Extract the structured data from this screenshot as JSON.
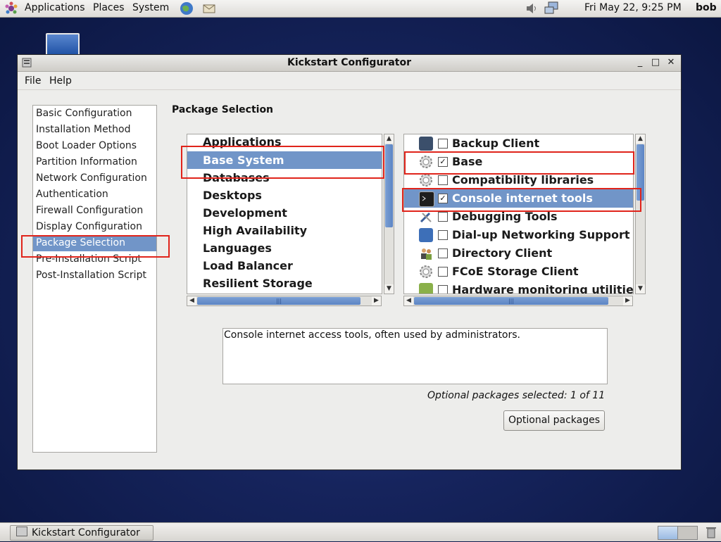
{
  "top_panel": {
    "menus": [
      "Applications",
      "Places",
      "System"
    ],
    "clock": "Fri May 22,  9:25 PM",
    "user": "bob"
  },
  "window": {
    "title": "Kickstart Configurator",
    "menu": [
      "File",
      "Help"
    ]
  },
  "nav": {
    "items": [
      "Basic Configuration",
      "Installation Method",
      "Boot Loader Options",
      "Partition Information",
      "Network Configuration",
      "Authentication",
      "Firewall Configuration",
      "Display Configuration",
      "Package Selection",
      "Pre-Installation Script",
      "Post-Installation Script"
    ],
    "selected": "Package Selection"
  },
  "main": {
    "section_title": "Package Selection",
    "groups": {
      "items": [
        "Applications",
        "Base System",
        "Databases",
        "Desktops",
        "Development",
        "High Availability",
        "Languages",
        "Load Balancer",
        "Resilient Storage"
      ],
      "selected": "Base System"
    },
    "packages": {
      "items": [
        {
          "label": "Backup Client",
          "checked": false,
          "icon": "backup-icon",
          "selected": false
        },
        {
          "label": "Base",
          "checked": true,
          "icon": "gear-icon",
          "selected": false
        },
        {
          "label": "Compatibility libraries",
          "checked": false,
          "icon": "gear-icon",
          "selected": false
        },
        {
          "label": "Console internet tools",
          "checked": true,
          "icon": "terminal-icon",
          "selected": true
        },
        {
          "label": "Debugging Tools",
          "checked": false,
          "icon": "tools-icon",
          "selected": false
        },
        {
          "label": "Dial-up Networking Support",
          "checked": false,
          "icon": "phone-icon",
          "selected": false
        },
        {
          "label": "Directory Client",
          "checked": false,
          "icon": "users-icon",
          "selected": false
        },
        {
          "label": "FCoE Storage Client",
          "checked": false,
          "icon": "gear-icon",
          "selected": false
        },
        {
          "label": "Hardware monitoring utilitie",
          "checked": false,
          "icon": "monitor-icon",
          "selected": false
        }
      ]
    },
    "description": "Console internet access tools, often used by administrators.",
    "optional_count": "Optional packages selected: 1 of 11",
    "optional_button": "Optional packages"
  },
  "taskbar": {
    "task_label": "Kickstart Configurator"
  },
  "colors": {
    "selection": "#7195c8",
    "annotation": "#e0241b"
  }
}
